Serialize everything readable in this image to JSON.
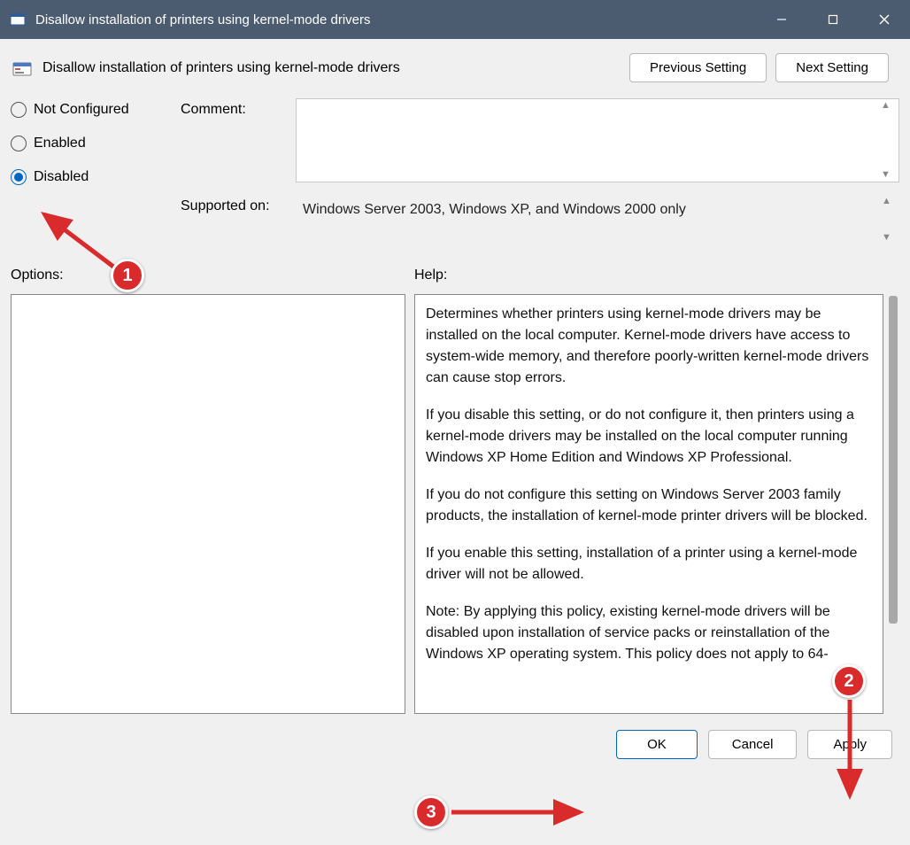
{
  "titlebar": {
    "title": "Disallow installation of printers using kernel-mode drivers"
  },
  "header": {
    "policy_title": "Disallow installation of printers using kernel-mode drivers",
    "prev_btn": "Previous Setting",
    "next_btn": "Next Setting"
  },
  "radios": {
    "not_configured": "Not Configured",
    "enabled": "Enabled",
    "disabled": "Disabled",
    "selected": "disabled"
  },
  "fields": {
    "comment_label": "Comment:",
    "comment_value": "",
    "supported_label": "Supported on:",
    "supported_value": "Windows Server 2003, Windows XP, and Windows 2000 only"
  },
  "panes": {
    "options_label": "Options:",
    "help_label": "Help:",
    "help_p1": "Determines whether printers using kernel-mode drivers may be installed on the local computer.  Kernel-mode drivers have access to system-wide memory, and therefore poorly-written kernel-mode drivers can cause stop errors.",
    "help_p2": "If you disable this setting, or do not configure it, then printers using a kernel-mode drivers may be installed on the local computer running Windows XP Home Edition and Windows XP Professional.",
    "help_p3": "If you do not configure this setting on Windows Server 2003 family products, the installation of kernel-mode printer drivers will be blocked.",
    "help_p4": "If you enable this setting, installation of a printer using a kernel-mode driver will not be allowed.",
    "help_p5": "Note: By applying this policy, existing kernel-mode drivers will be disabled upon installation of service packs or reinstallation of the Windows XP operating system. This policy does not apply to 64-"
  },
  "footer": {
    "ok": "OK",
    "cancel": "Cancel",
    "apply": "Apply"
  },
  "annotations": {
    "n1": "1",
    "n2": "2",
    "n3": "3"
  }
}
